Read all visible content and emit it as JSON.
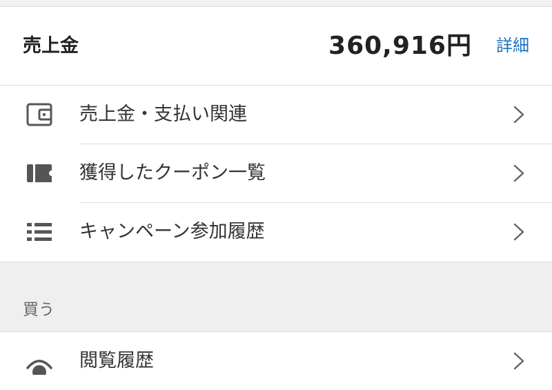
{
  "sales": {
    "label": "売上金",
    "amount": "360,916円",
    "detail_link": "詳細"
  },
  "menu": [
    {
      "label": "売上金・支払い関連",
      "icon": "wallet-icon"
    },
    {
      "label": "獲得したクーポン一覧",
      "icon": "coupon-icon"
    },
    {
      "label": "キャンペーン参加履歴",
      "icon": "list-icon"
    }
  ],
  "section": {
    "label": "買う"
  },
  "buy_menu": [
    {
      "label": "閲覧履歴",
      "icon": "eye-icon"
    }
  ],
  "colors": {
    "accent": "#1a73c2",
    "icon": "#555555",
    "divider": "#dcdcdc",
    "section_bg": "#efefef"
  }
}
